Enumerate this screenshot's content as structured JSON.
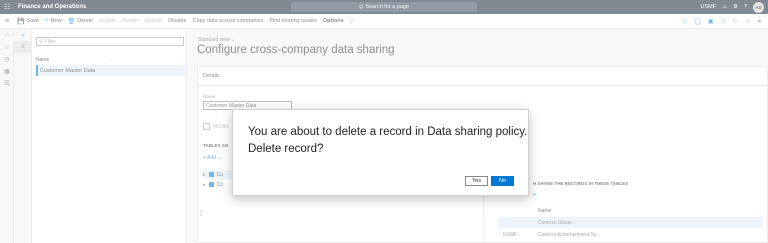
{
  "topbar": {
    "app_title": "Finance and Operations",
    "search_placeholder": "Search for a page",
    "company": "USMF",
    "avatar_initials": "AD"
  },
  "actionpane": {
    "save": "Save",
    "new": "New",
    "delete": "Delete",
    "enable": "Enable",
    "revert": "Revert",
    "update": "Update",
    "disable": "Disable",
    "copy": "Copy data across companies",
    "find": "Find sharing issues",
    "options": "Options"
  },
  "list": {
    "filter_placeholder": "Filter",
    "column_name": "Name",
    "rows": [
      "Customer Master Data"
    ]
  },
  "main": {
    "view_label": "Standard view",
    "page_title": "Configure cross-company data sharing",
    "details_header": "Details",
    "name_label": "Name",
    "name_value": "Customer Master Data",
    "modified_label": "Modifie",
    "tables_label": "TABLES AN",
    "add_label": "Add",
    "tree": [
      "Cu",
      "Cu"
    ],
    "share_label": "H SHARE THE RECORDS IN THESE TABLES",
    "share_add": "e",
    "grid_column": "Name",
    "grid_rows": [
      {
        "company": "",
        "name": "Contoso Group"
      },
      {
        "company": "USMF",
        "name": "Contoso Entertainment Sy..."
      }
    ]
  },
  "dialog": {
    "message": "You are about to delete a record in Data sharing policy. Delete record?",
    "yes": "Yes",
    "no": "No"
  },
  "colors": {
    "topbar": "#1a2a3a",
    "accent": "#0078d4",
    "selection": "#deecf9"
  }
}
